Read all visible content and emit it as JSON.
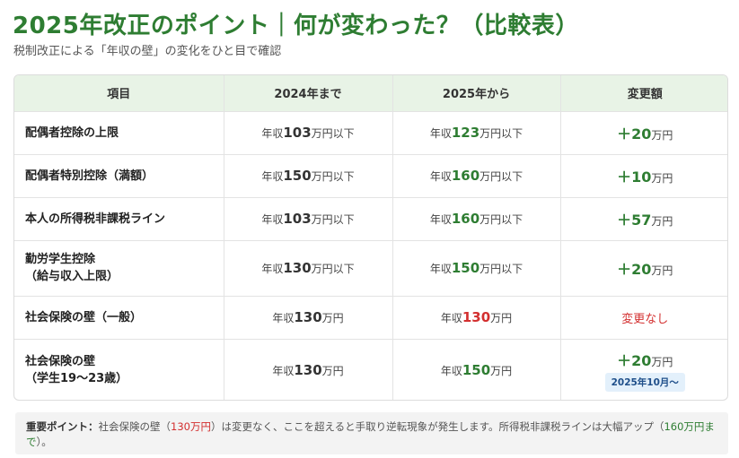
{
  "header": {
    "title": "2025年改正のポイント｜何が変わった？（比較表）",
    "subtitle": "税制改正による「年収の壁」の変化をひと目で確認"
  },
  "table": {
    "columns": [
      "項目",
      "2024年まで",
      "2025年から",
      "変更額"
    ],
    "rows": [
      {
        "item": [
          "配偶者控除の上限"
        ],
        "before": {
          "prefix": "年収",
          "num": "103",
          "suffix": "万円以下"
        },
        "after": {
          "prefix": "年収",
          "num": "123",
          "suffix": "万円以下"
        },
        "change": {
          "amount": "＋20",
          "unit": "万円"
        }
      },
      {
        "item": [
          "配偶者特別控除（満額）"
        ],
        "before": {
          "prefix": "年収",
          "num": "150",
          "suffix": "万円以下"
        },
        "after": {
          "prefix": "年収",
          "num": "160",
          "suffix": "万円以下"
        },
        "change": {
          "amount": "＋10",
          "unit": "万円"
        }
      },
      {
        "item": [
          "本人の所得税非課税ライン"
        ],
        "before": {
          "prefix": "年収",
          "num": "103",
          "suffix": "万円以下"
        },
        "after": {
          "prefix": "年収",
          "num": "160",
          "suffix": "万円以下"
        },
        "change": {
          "amount": "＋57",
          "unit": "万円"
        }
      },
      {
        "item": [
          "勤労学生控除",
          "（給与収入上限）"
        ],
        "before": {
          "prefix": "年収",
          "num": "130",
          "suffix": "万円以下"
        },
        "after": {
          "prefix": "年収",
          "num": "150",
          "suffix": "万円以下"
        },
        "change": {
          "amount": "＋20",
          "unit": "万円"
        }
      },
      {
        "item": [
          "社会保険の壁（一般）"
        ],
        "before": {
          "prefix": "年収",
          "num": "130",
          "suffix": "万円"
        },
        "after": {
          "prefix": "年収",
          "num": "130",
          "suffix": "万円"
        },
        "change": {
          "text": "変更なし"
        }
      },
      {
        "item": [
          "社会保険の壁",
          "（学生19〜23歳）"
        ],
        "before": {
          "prefix": "年収",
          "num": "130",
          "suffix": "万円"
        },
        "after": {
          "prefix": "年収",
          "num": "150",
          "suffix": "万円"
        },
        "change": {
          "amount": "＋20",
          "unit": "万円",
          "badge": "2025年10月〜"
        }
      }
    ]
  },
  "note": {
    "label": "重要ポイント：",
    "text1": "社会保険の壁（",
    "highlight1": "130万円",
    "text2": "）は変更なく、ここを超えると手取り逆転現象が発生します。所得税非課税ラインは大幅アップ（",
    "highlight2": "160万円まで",
    "text3": "）。"
  },
  "colors": {
    "title_green": "#2e7d32",
    "header_bg": "#e8f3e6",
    "accent_red": "#d32f2f",
    "badge_bg": "#e3f0fb",
    "note_bg": "#f3f3f3"
  }
}
